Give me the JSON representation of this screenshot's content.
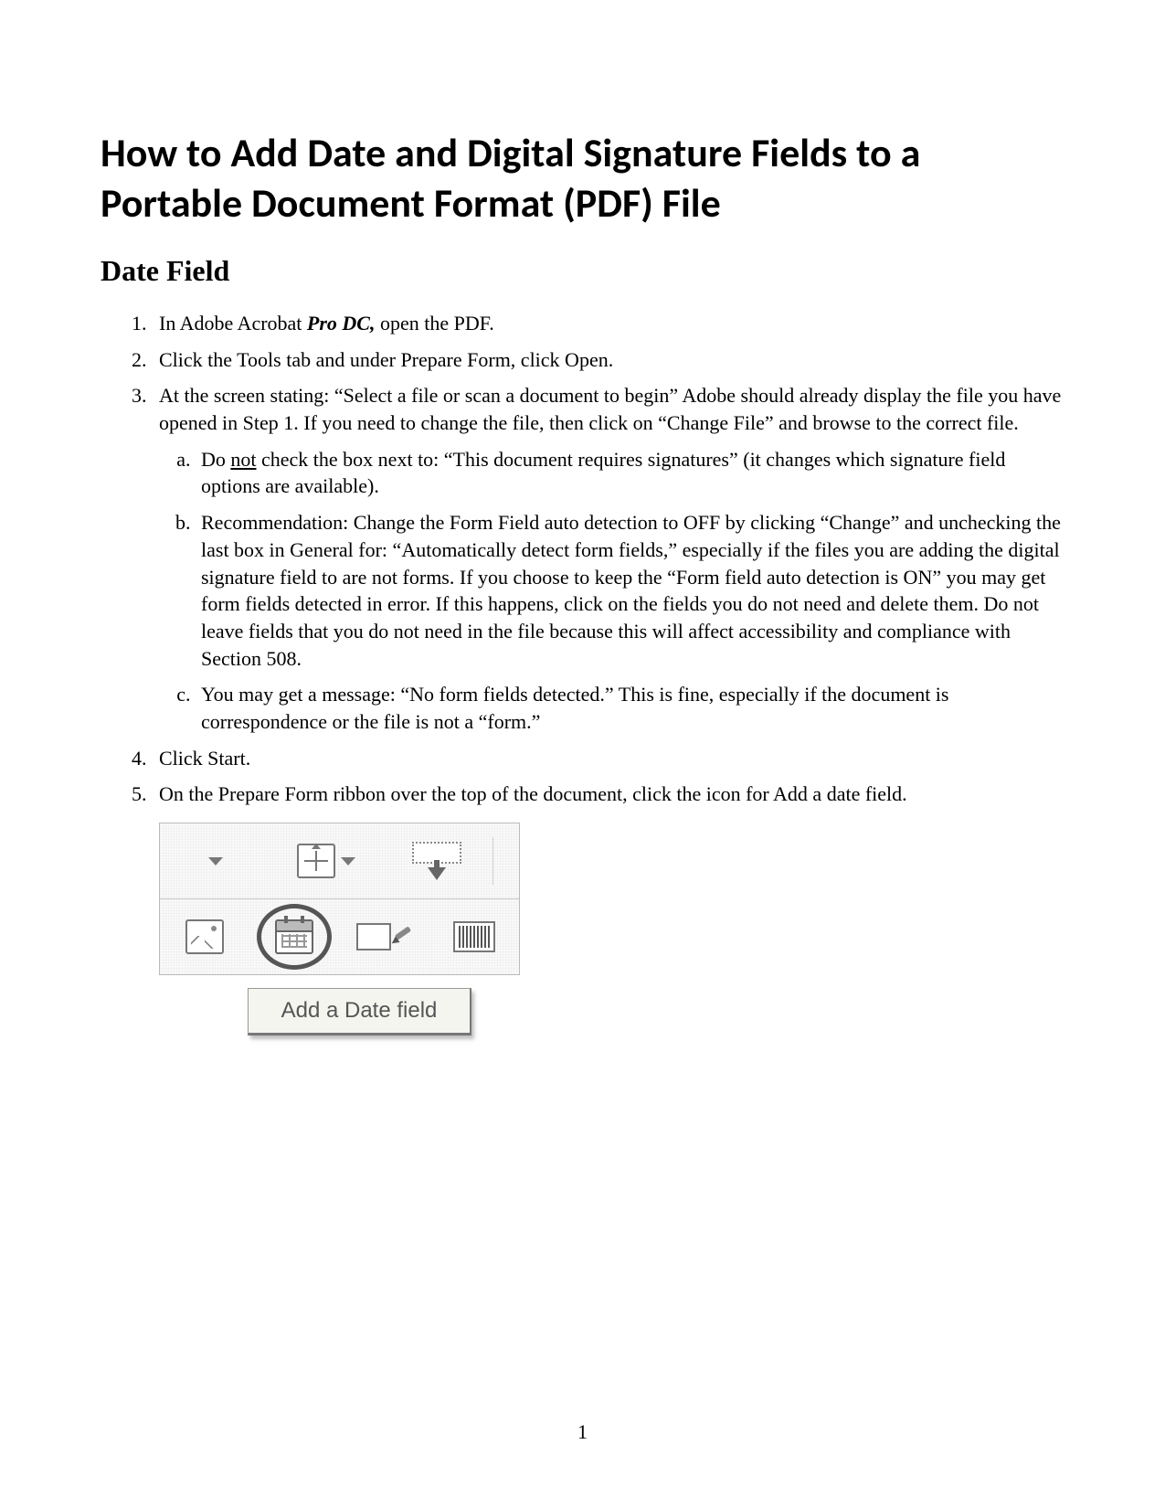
{
  "title": "How to Add Date and Digital Signature Fields to a Portable Document Format (PDF) File",
  "section_heading": "Date Field",
  "steps": {
    "s1_pre": "In Adobe Acrobat ",
    "s1_em": "Pro DC,",
    "s1_post": " open the PDF.",
    "s2": "Click the Tools tab and under Prepare Form, click Open.",
    "s3": "At the screen stating: “Select a file or scan a document to begin” Adobe should already display the file you have opened in Step 1.  If you need to change the file, then click on “Change File” and browse to the correct file.",
    "s3a_pre": "Do ",
    "s3a_u": "not",
    "s3a_post": " check the box next to: “This document requires signatures” (it changes which signature field options are available).",
    "s3b": "Recommendation:  Change the Form Field auto detection to OFF by clicking “Change” and unchecking the last box in General for: “Automatically detect form fields,” especially if the files you are adding the digital signature field to are not forms.  If you choose to keep the “Form field auto detection is ON” you may get form fields detected in error.  If this happens, click on the fields you do not need and delete them.  Do not leave fields that you do not need in the file because this will affect accessibility and compliance with Section 508.",
    "s3c": "You may get a message: “No form fields detected.”  This is fine, especially if the document is correspondence or the file is not a “form.”",
    "s4": "Click Start.",
    "s5": "On the Prepare Form ribbon over the top of the document, click the icon for Add a date field."
  },
  "ribbon": {
    "tooltip": "Add a Date field"
  },
  "page_number": "1"
}
